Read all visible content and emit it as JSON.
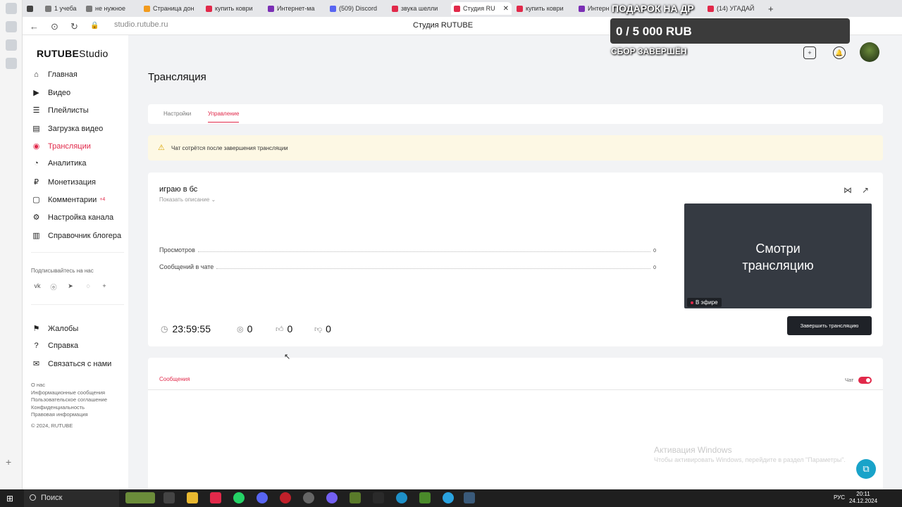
{
  "browser": {
    "tabs": [
      {
        "label": "1 учеба",
        "color": "#7b7b7b"
      },
      {
        "label": "не нужное",
        "color": "#7b7b7b"
      },
      {
        "label": "Страница дон",
        "color": "#f29b1d"
      },
      {
        "label": "купить коври",
        "color": "#e1294a"
      },
      {
        "label": "Интернет-ма",
        "color": "#7b2fb5"
      },
      {
        "label": "(509) Discord",
        "color": "#5865f2"
      },
      {
        "label": "звука шелли",
        "color": "#e1294a"
      },
      {
        "label": "Студия RU",
        "color": "#e1294a"
      },
      {
        "label": "купить коври",
        "color": "#e1294a"
      },
      {
        "label": "Интерн",
        "color": "#7b2fb5"
      },
      {
        "label": "(14) УГАДАЙ",
        "color": "#e1294a"
      }
    ],
    "url": "studio.rutube.ru",
    "page_title": "Студия RUTUBE"
  },
  "donation": {
    "title": "ПОДАРОК НА ДР",
    "amount": "0 / 5 000 RUB",
    "status": "СБОР ЗАВЕРШЁН"
  },
  "logo": {
    "brand": "RUTUBE",
    "suffix": "Studio"
  },
  "sidebar": {
    "items": [
      {
        "label": "Главная",
        "icon": "home-icon"
      },
      {
        "label": "Видео",
        "icon": "video-icon"
      },
      {
        "label": "Плейлисты",
        "icon": "playlist-icon"
      },
      {
        "label": "Загрузка видео",
        "icon": "upload-icon"
      },
      {
        "label": "Трансляции",
        "icon": "broadcast-icon"
      },
      {
        "label": "Аналитика",
        "icon": "analytics-icon"
      },
      {
        "label": "Монетизация",
        "icon": "money-icon"
      },
      {
        "label": "Комментарии",
        "icon": "comments-icon",
        "badge": "+4"
      },
      {
        "label": "Настройка канала",
        "icon": "gear-icon"
      },
      {
        "label": "Справочник блогера",
        "icon": "book-icon"
      }
    ],
    "subscribe_label": "Подписывайтесь на нас",
    "bottom_items": [
      {
        "label": "Жалобы",
        "icon": "flag-icon"
      },
      {
        "label": "Справка",
        "icon": "help-icon"
      },
      {
        "label": "Связаться с нами",
        "icon": "mail-icon"
      }
    ],
    "footer_links": [
      "О нас",
      "Информационные сообщения",
      "Пользовательское соглашение",
      "Конфиденциальность",
      "Правовая информация",
      "© 2024, RUTUBE"
    ]
  },
  "page": {
    "title": "Трансляция",
    "tabs": [
      "Настройки",
      "Управление"
    ],
    "warning": "Чат сотрётся после завершения трансляции",
    "stream": {
      "title": "играю в бс",
      "show_description": "Показать описание",
      "stats": [
        {
          "label": "Просмотров",
          "value": "0"
        },
        {
          "label": "Сообщений в чате",
          "value": "0"
        }
      ],
      "timer": "23:59:55",
      "viewers": "0",
      "likes": "0",
      "dislikes": "0",
      "preview_text_1": "Смотри",
      "preview_text_2": "трансляцию",
      "live_label": "В эфире",
      "end_button": "Завершить трансляцию"
    },
    "chat": {
      "tab": "Сообщения",
      "toggle_label": "Чат"
    }
  },
  "windows_activation": {
    "title": "Активация Windows",
    "subtitle": "Чтобы активировать Windows, перейдите в раздел \"Параметры\"."
  },
  "taskbar": {
    "search": "Поиск",
    "lang": "РУС",
    "time": "20:11",
    "date": "24.12.2024"
  }
}
